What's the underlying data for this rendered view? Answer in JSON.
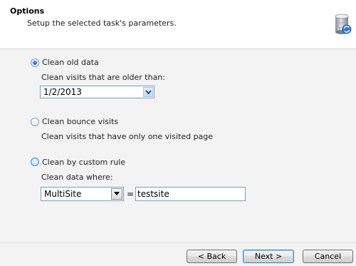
{
  "header": {
    "title": "Options",
    "subtitle": "Setup the selected task's parameters.",
    "icon": "database-sync-icon"
  },
  "options": {
    "clean_old": {
      "label": "Clean old data",
      "selected": true,
      "field_label": "Clean visits that are older than:",
      "date_value": "1/2/2013"
    },
    "clean_bounce": {
      "label": "Clean bounce visits",
      "selected": false,
      "description": "Clean visits that have only one visited page"
    },
    "clean_custom": {
      "label": "Clean by custom rule",
      "selected": false,
      "field_label": "Clean data where:",
      "field_value": "MultiSite",
      "operator": "=",
      "value": "testsite"
    }
  },
  "footer": {
    "back_label": "< Back",
    "next_label": "Next >",
    "cancel_label": "Cancel"
  }
}
